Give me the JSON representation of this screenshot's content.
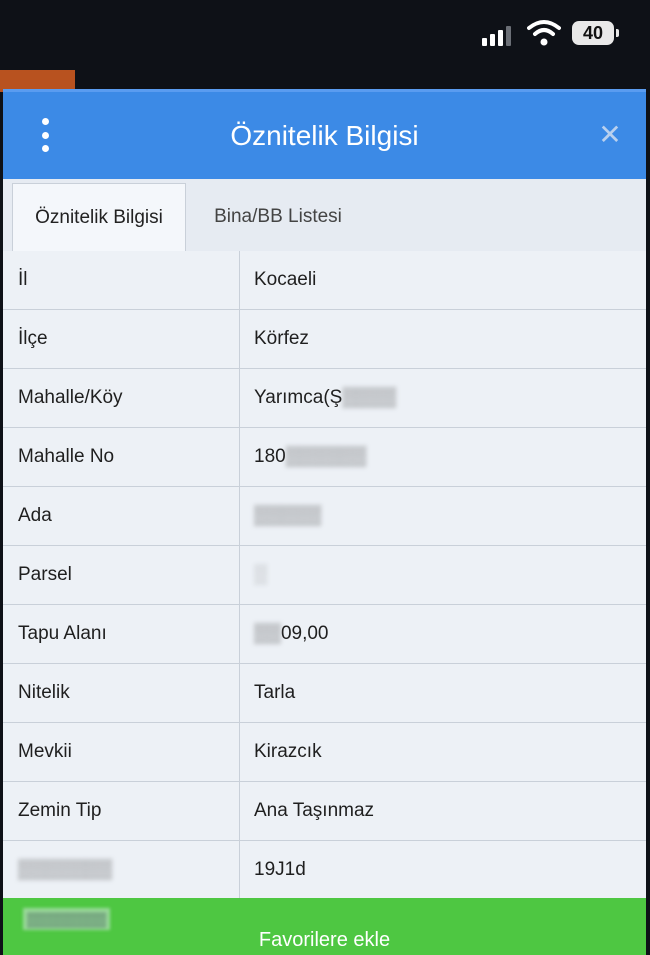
{
  "status_bar": {
    "battery": "40",
    "signal_bars_active": 3,
    "signal_bars_total": 4
  },
  "modal": {
    "title": "Öznitelik Bilgisi",
    "menu_icon": "kebab-menu-icon",
    "close_icon": "close-icon",
    "header_color": "#3c8ae6"
  },
  "tabs": [
    {
      "label": "Öznitelik Bilgisi",
      "active": true
    },
    {
      "label": "Bina/BB Listesi",
      "active": false
    }
  ],
  "rows": [
    {
      "label": "İl",
      "value": "Kocaeli"
    },
    {
      "label": "İlçe",
      "value": "Körfez"
    },
    {
      "label": "Mahalle/Köy",
      "value": "Yarımca(Ş"
    },
    {
      "label": "Mahalle No",
      "value": "180"
    },
    {
      "label": "Ada",
      "value": ""
    },
    {
      "label": "Parsel",
      "value": ""
    },
    {
      "label": "Tapu Alanı",
      "value": "09,00"
    },
    {
      "label": "Nitelik",
      "value": "Tarla"
    },
    {
      "label": "Mevkii",
      "value": "Kirazcık"
    },
    {
      "label": "Zemin Tip",
      "value": "Ana Taşınmaz"
    },
    {
      "label": "",
      "value": "19J1d"
    }
  ],
  "favorite_button": {
    "label": "Favorilere ekle",
    "color": "#4ec742"
  }
}
